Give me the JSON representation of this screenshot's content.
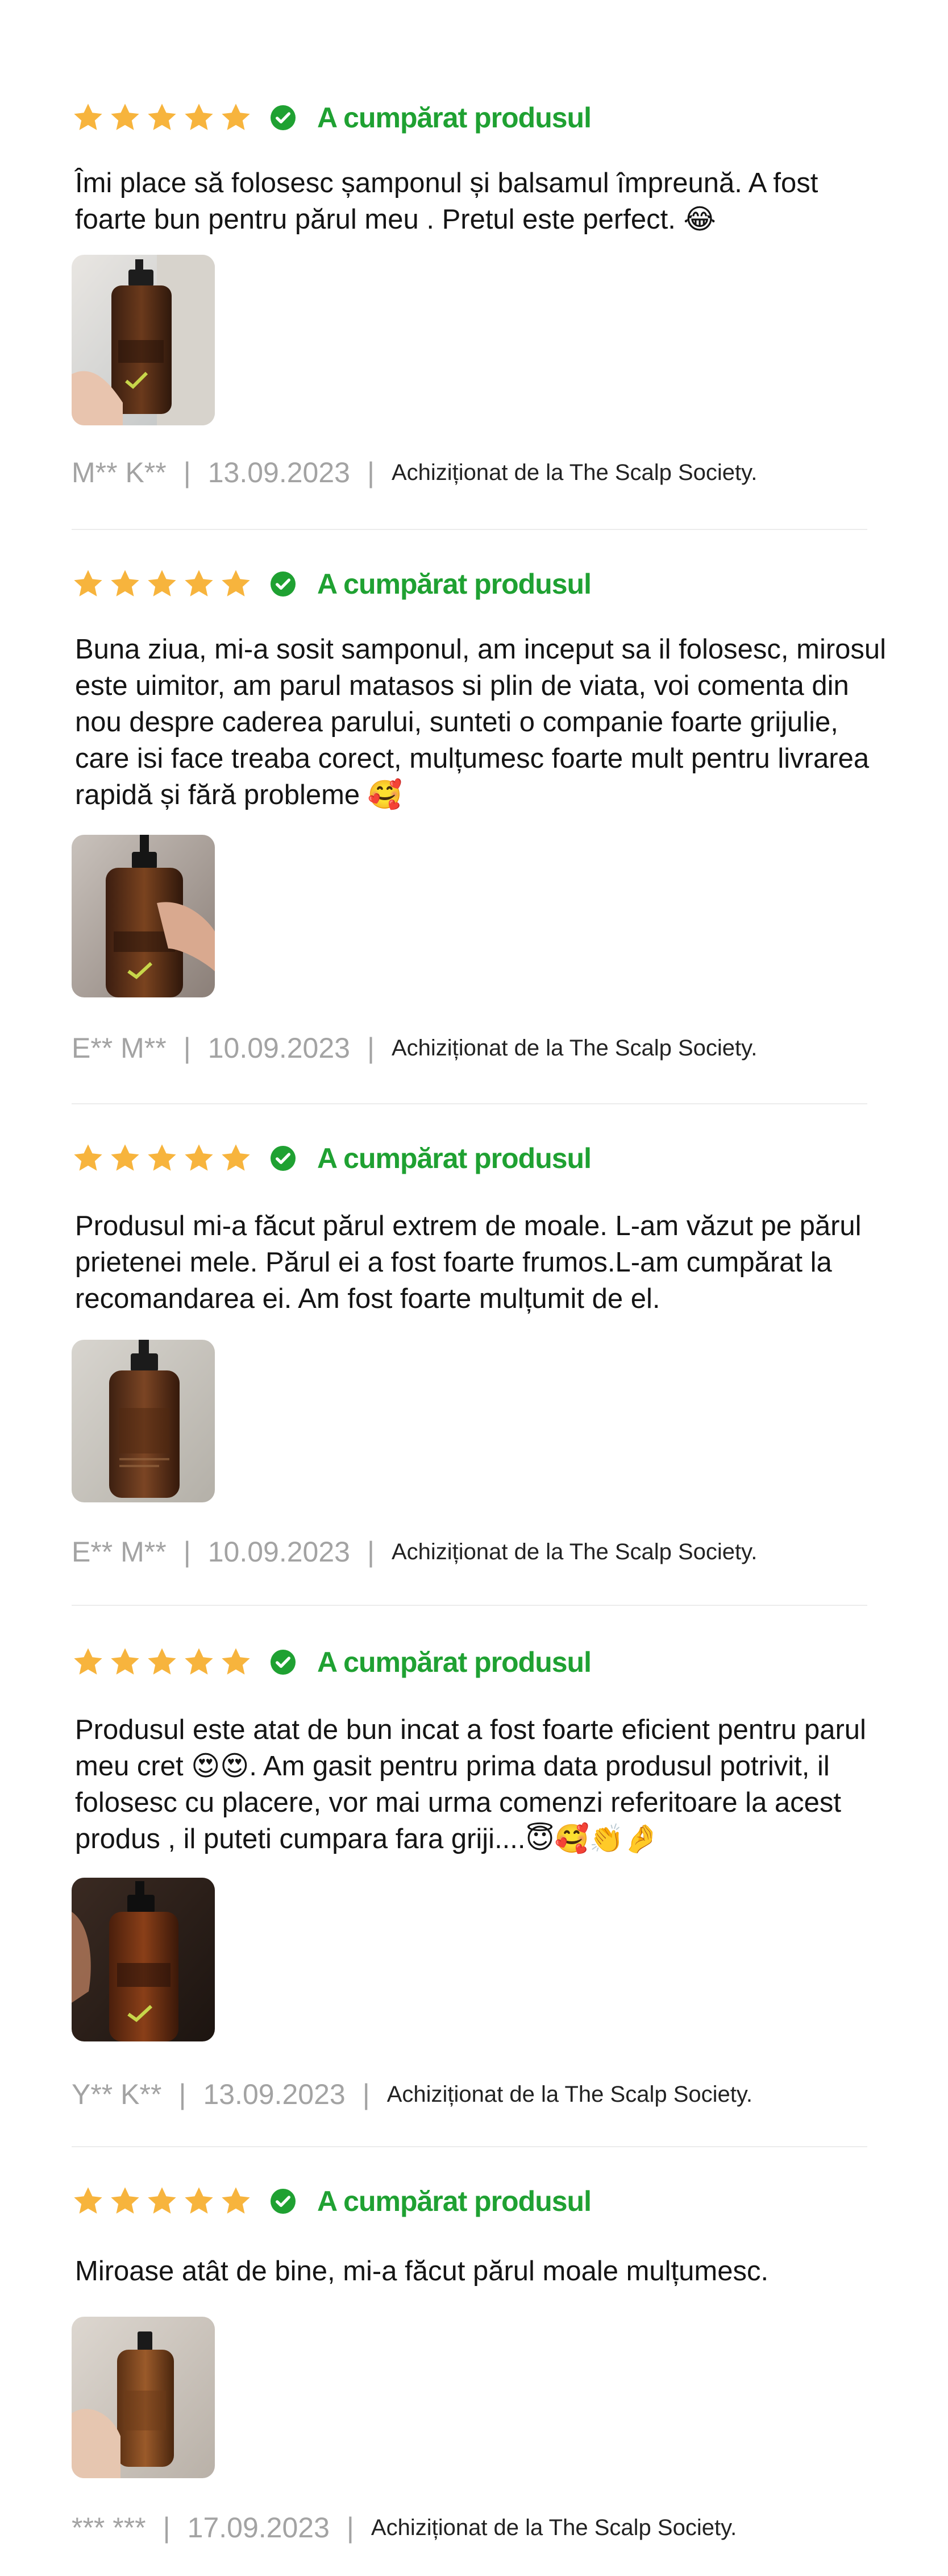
{
  "colors": {
    "star": "#f7b43d",
    "verified_green": "#1fa132",
    "meta_gray": "#a3a3a3",
    "divider": "#ececec"
  },
  "icons": {
    "star": "star-icon",
    "verified": "check-circle-icon"
  },
  "reviews": [
    {
      "rating": 5,
      "verified_label": "A cumpărat produsul",
      "text": "Îmi place să folosesc șamponul și balsamul  împreună. A fost foarte bun pentru părul meu . Pretul este perfect. 😂",
      "author": "M** K**",
      "date": "13.09.2023",
      "purchased_from": "Achiziționat de la The Scalp Society."
    },
    {
      "rating": 5,
      "verified_label": "A cumpărat produsul",
      "text": "Buna ziua, mi-a sosit samponul, am inceput sa il folosesc, mirosul este uimitor, am parul matasos si plin de viata, voi comenta din nou despre caderea parului, sunteti o companie foarte grijulie, care isi face treaba corect, mulțumesc foarte mult pentru livrarea rapidă și fără probleme  🥰",
      "author": "E** M**",
      "date": "10.09.2023",
      "purchased_from": "Achiziționat de la The Scalp Society."
    },
    {
      "rating": 5,
      "verified_label": "A cumpărat produsul",
      "text": "Produsul mi-a făcut părul extrem de moale. L-am văzut pe părul prietenei mele. Părul ei a fost foarte frumos.L-am cumpărat la recomandarea ei. Am fost foarte mulțumit de el.",
      "author": "E** M**",
      "date": "10.09.2023",
      "purchased_from": "Achiziționat de la The Scalp Society."
    },
    {
      "rating": 5,
      "verified_label": "A cumpărat produsul",
      "text": "Produsul este atat de bun incat a fost foarte eficient pentru parul meu cret 😍😍. Am gasit pentru prima data produsul potrivit, il folosesc cu placere, vor mai urma comenzi referitoare la acest produs , il puteti cumpara fara griji....😇🥰👏🤌",
      "author": "Y** K**",
      "date": "13.09.2023",
      "purchased_from": "Achiziționat de la The Scalp Society."
    },
    {
      "rating": 5,
      "verified_label": "A cumpărat produsul",
      "text": "Miroase atât de bine, mi-a făcut părul moale mulțumesc.",
      "author": "*** ***",
      "date": "17.09.2023",
      "purchased_from": "Achiziționat de la The Scalp Society."
    }
  ]
}
